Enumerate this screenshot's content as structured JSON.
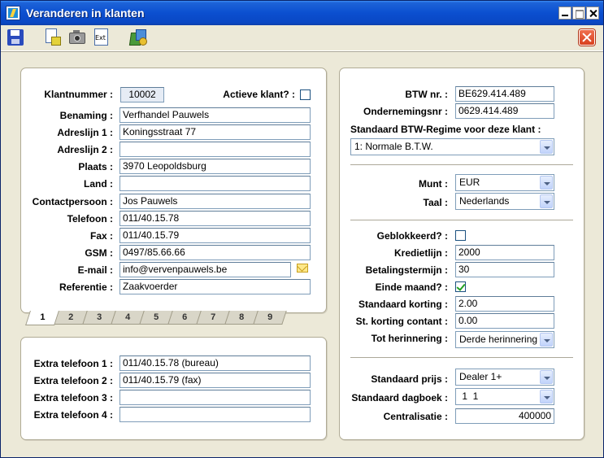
{
  "window": {
    "title": "Veranderen in klanten"
  },
  "toolbar": {
    "save_icon": "save-icon",
    "document_icon": "document-icon",
    "camera_icon": "camera-icon",
    "export_icon": "export-icon",
    "export_label": "Ext",
    "calculator_icon": "calculator-icon",
    "close_icon": "close-icon"
  },
  "main": {
    "klantnummer_label": "Klantnummer :",
    "klantnummer": "10002",
    "actief_label": "Actieve klant? :",
    "actief_checked": false,
    "benaming_label": "Benaming :",
    "benaming": "Verfhandel Pauwels",
    "adres1_label": "Adreslijn 1 :",
    "adres1": "Koningsstraat 77",
    "adres2_label": "Adreslijn 2 :",
    "adres2": "",
    "plaats_label": "Plaats :",
    "plaats": "3970 Leopoldsburg",
    "land_label": "Land :",
    "land": "",
    "contact_label": "Contactpersoon :",
    "contact": "Jos Pauwels",
    "telefoon_label": "Telefoon :",
    "telefoon": "011/40.15.78",
    "fax_label": "Fax :",
    "fax": "011/40.15.79",
    "gsm_label": "GSM :",
    "gsm": "0497/85.66.66",
    "email_label": "E-mail :",
    "email": "info@vervenpauwels.be",
    "referentie_label": "Referentie :",
    "referentie": "Zaakvoerder"
  },
  "tabs": [
    "1",
    "2",
    "3",
    "4",
    "5",
    "6",
    "7",
    "8",
    "9"
  ],
  "extra": {
    "tel1_label": "Extra telefoon 1 :",
    "tel1": "011/40.15.78 (bureau)",
    "tel2_label": "Extra telefoon 2 :",
    "tel2": "011/40.15.79 (fax)",
    "tel3_label": "Extra telefoon 3 :",
    "tel3": "",
    "tel4_label": "Extra telefoon 4 :",
    "tel4": ""
  },
  "right": {
    "btw_label": "BTW nr. :",
    "btw": "BE629.414.489",
    "ondernemingsnr_label": "Ondernemingsnr :",
    "ondernemingsnr": "0629.414.489",
    "regime_label": "Standaard BTW-Regime voor deze klant :",
    "regime": "1: Normale B.T.W.",
    "munt_label": "Munt :",
    "munt": "EUR",
    "taal_label": "Taal :",
    "taal": "Nederlands",
    "geblokkeerd_label": "Geblokkeerd? :",
    "geblokkeerd_checked": false,
    "kredietlijn_label": "Kredietlijn :",
    "kredietlijn": "2000",
    "betalingstermijn_label": "Betalingstermijn :",
    "betalingstermijn": "30",
    "einde_maand_label": "Einde maand? :",
    "einde_maand_checked": true,
    "korting_label": "Standaard korting :",
    "korting": "2.00",
    "korting_contant_label": "St. korting contant :",
    "korting_contant": "0.00",
    "herinnering_label": "Tot herinnering :",
    "herinnering": "Derde herinnering",
    "prijs_label": "Standaard prijs :",
    "prijs": "Dealer 1+",
    "dagboek_label": "Standaard dagboek :",
    "dagboek": " 1  1",
    "centralisatie_label": "Centralisatie :",
    "centralisatie": "400000"
  }
}
